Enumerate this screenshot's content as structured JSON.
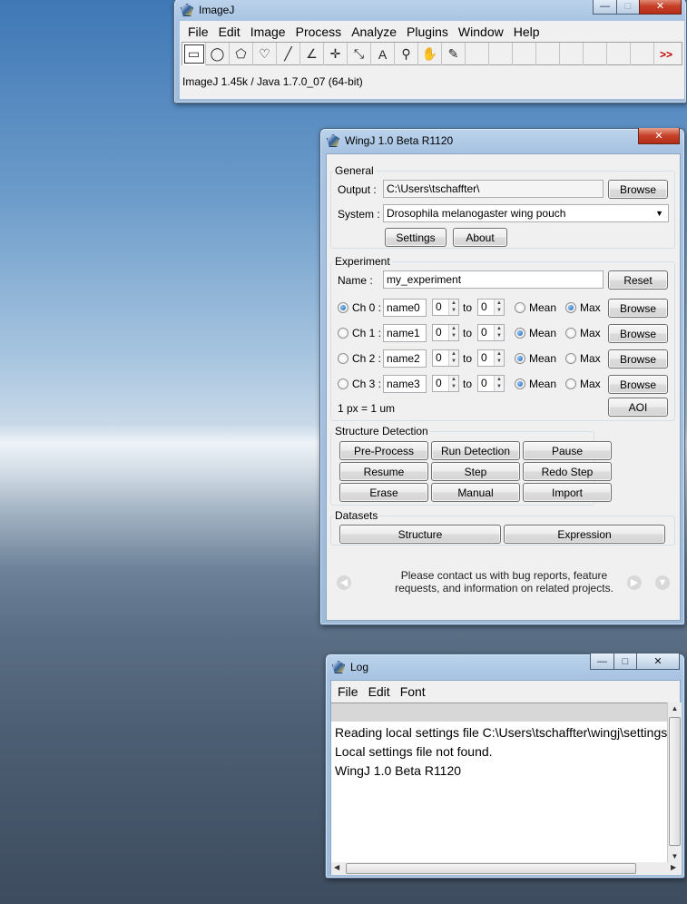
{
  "imagej": {
    "title": "ImageJ",
    "menu": [
      "File",
      "Edit",
      "Image",
      "Process",
      "Analyze",
      "Plugins",
      "Window",
      "Help"
    ],
    "tools": [
      "rectangle-tool-icon",
      "oval-tool-icon",
      "polygon-tool-icon",
      "freehand-tool-icon",
      "line-tool-icon",
      "angle-tool-icon",
      "point-tool-icon",
      "wand-tool-icon",
      "text-tool-icon",
      "magnifier-tool-icon",
      "hand-tool-icon",
      "dropper-tool-icon"
    ],
    "more": ">>",
    "status": "ImageJ 1.45k / Java 1.7.0_07 (64-bit)"
  },
  "wingj": {
    "title": "WingJ 1.0 Beta R1120",
    "general": {
      "label": "General",
      "output_label": "Output :",
      "output_value": "C:\\Users\\tschaffter\\",
      "browse": "Browse",
      "system_label": "System :",
      "system_value": "Drosophila melanogaster wing pouch",
      "settings": "Settings",
      "about": "About"
    },
    "experiment": {
      "label": "Experiment",
      "name_label": "Name :",
      "name_value": "my_experiment",
      "reset": "Reset",
      "to": "to",
      "mean": "Mean",
      "max": "Max",
      "browse": "Browse",
      "scale": "1 px = 1 um",
      "aoi": "AOI",
      "channels": [
        {
          "label": "Ch 0 :",
          "name": "name0",
          "from": "0",
          "to": "0"
        },
        {
          "label": "Ch 1 :",
          "name": "name1",
          "from": "0",
          "to": "0"
        },
        {
          "label": "Ch 2 :",
          "name": "name2",
          "from": "0",
          "to": "0"
        },
        {
          "label": "Ch 3 :",
          "name": "name3",
          "from": "0",
          "to": "0"
        }
      ]
    },
    "structure": {
      "label": "Structure Detection",
      "buttons": [
        "Pre-Process",
        "Run Detection",
        "Pause",
        "Resume",
        "Step",
        "Redo Step",
        "Erase",
        "Manual",
        "Import"
      ]
    },
    "datasets": {
      "label": "Datasets",
      "structure": "Structure",
      "expression": "Expression"
    },
    "footer": {
      "line1": "Please contact us with bug reports, feature",
      "line2": "requests, and information on related projects."
    }
  },
  "log": {
    "title": "Log",
    "menu": [
      "File",
      "Edit",
      "Font"
    ],
    "lines": [
      "Reading local settings file C:\\Users\\tschaffter\\wingj\\settings",
      "Local settings file not found.",
      "WingJ 1.0 Beta R1120"
    ]
  },
  "window_controls": {
    "minimize": "—",
    "maximize": "□",
    "close": "✕"
  }
}
